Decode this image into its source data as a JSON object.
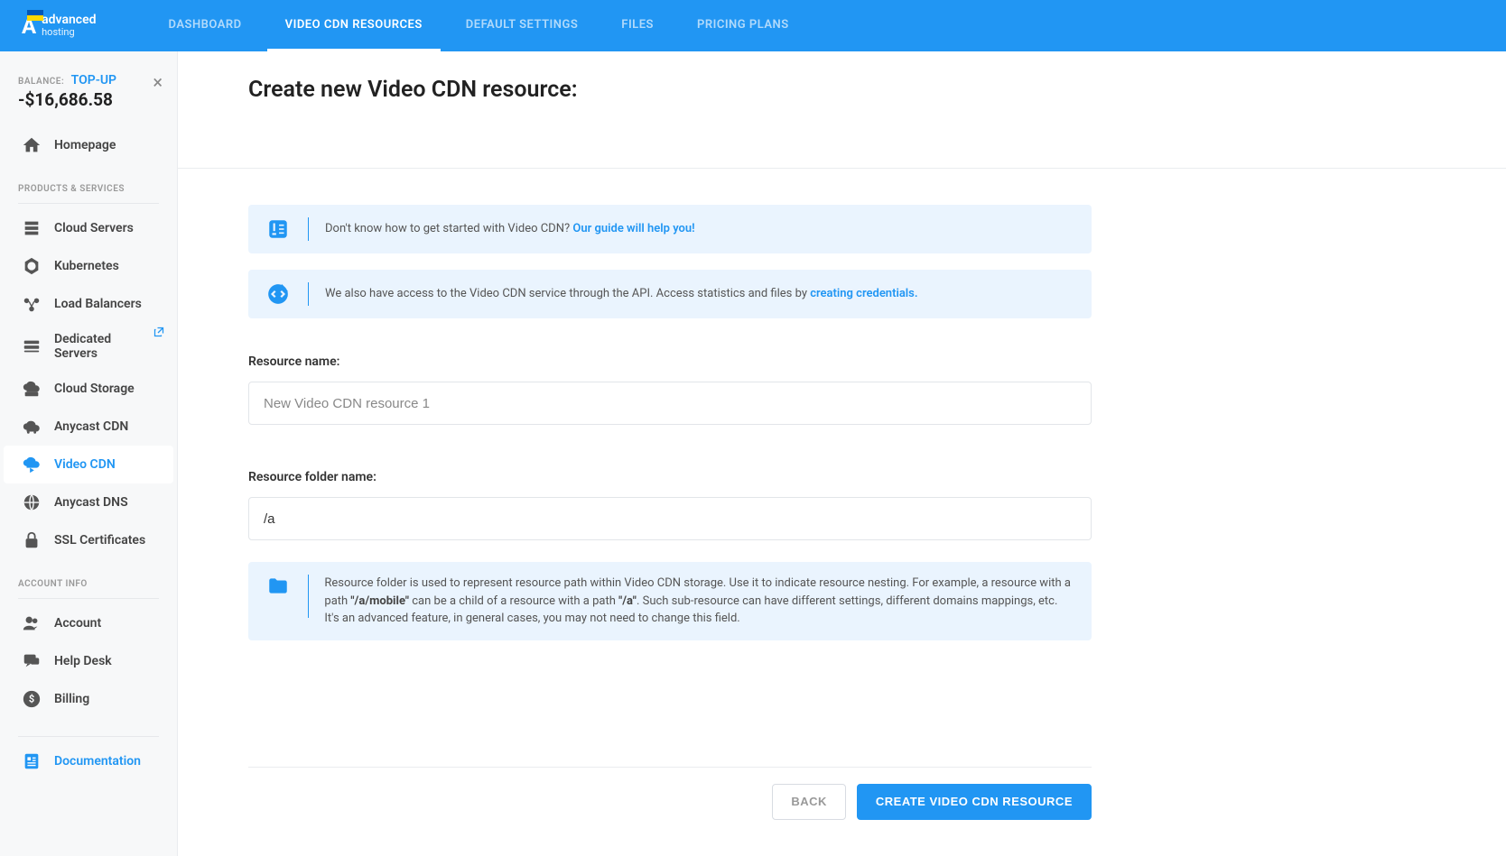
{
  "brand": {
    "name": "advanced",
    "sub": "hosting"
  },
  "topNav": [
    {
      "label": "DASHBOARD",
      "active": false
    },
    {
      "label": "VIDEO CDN RESOURCES",
      "active": true
    },
    {
      "label": "DEFAULT SETTINGS",
      "active": false
    },
    {
      "label": "FILES",
      "active": false
    },
    {
      "label": "PRICING PLANS",
      "active": false
    }
  ],
  "balance": {
    "label": "BALANCE:",
    "topup": "TOP-UP",
    "amount": "-$16,686.58"
  },
  "sidebar": {
    "homepage": "Homepage",
    "productsHeading": "PRODUCTS & SERVICES",
    "products": [
      {
        "label": "Cloud Servers"
      },
      {
        "label": "Kubernetes"
      },
      {
        "label": "Load Balancers"
      },
      {
        "label": "Dedicated Servers",
        "external": true
      },
      {
        "label": "Cloud Storage"
      },
      {
        "label": "Anycast CDN"
      },
      {
        "label": "Video CDN",
        "active": true
      },
      {
        "label": "Anycast DNS"
      },
      {
        "label": "SSL Certificates"
      }
    ],
    "accountHeading": "ACCOUNT INFO",
    "account": [
      {
        "label": "Account"
      },
      {
        "label": "Help Desk"
      },
      {
        "label": "Billing"
      }
    ],
    "documentation": "Documentation"
  },
  "page": {
    "title": "Create new Video CDN resource:",
    "guideBox": {
      "text": "Don't know how to get started with Video CDN? ",
      "link": "Our guide will help you!"
    },
    "apiBox": {
      "text": "We also have access to the Video CDN service through the API. Access statistics and files by ",
      "link": "creating credentials."
    },
    "folderInfo": {
      "p1": "Resource folder is used to represent resource path within Video CDN storage. Use it to indicate resource nesting. For example, a resource with a path ",
      "s1": "\"/a/mobile\"",
      "p2": " can be a child of a resource with a path ",
      "s2": "\"/a\"",
      "p3": ". Such sub-resource can have different settings, different domains mappings, etc. It's an advanced feature, in general cases, you may not need to change this field."
    },
    "form": {
      "resourceNameLabel": "Resource name:",
      "resourceNameValue": "New Video CDN resource 1",
      "folderNameLabel": "Resource folder name:",
      "folderNameValue": "/a"
    },
    "buttons": {
      "back": "BACK",
      "submit": "CREATE VIDEO CDN RESOURCE"
    }
  }
}
